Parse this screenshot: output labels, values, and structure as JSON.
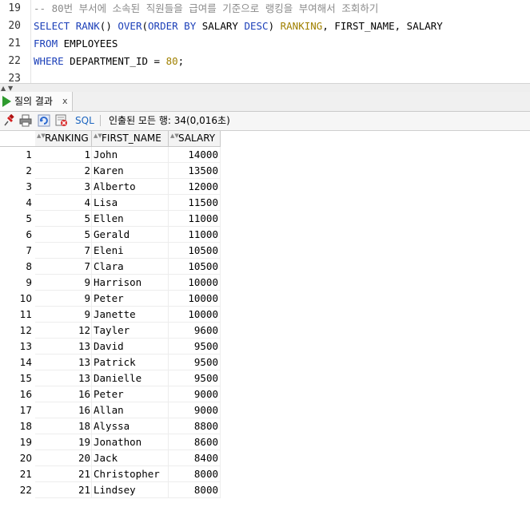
{
  "editor": {
    "lines": [
      {
        "num": "19",
        "comment": "-- 80번 부서에 소속된 직원들을 급여를 기준으로 랭킹을 부여해서 조회하기"
      },
      {
        "num": "20",
        "tokens": [
          "SELECT",
          " ",
          "RANK",
          "() ",
          "OVER",
          "(",
          "ORDER BY",
          " SALARY ",
          "DESC",
          ") ",
          "RANKING",
          ", FIRST_NAME, SALARY"
        ]
      },
      {
        "num": "21",
        "tokens": [
          "FROM",
          " EMPLOYEES"
        ]
      },
      {
        "num": "22",
        "tokens": [
          "WHERE",
          " DEPARTMENT_ID = ",
          "80",
          ";"
        ]
      },
      {
        "num": "23"
      }
    ]
  },
  "splitter": {
    "up_arrow": "▲",
    "down_arrow": "▼"
  },
  "results_tab": {
    "label": "질의 결과",
    "close": "x"
  },
  "toolbar": {
    "icons": [
      "pin-icon",
      "print-icon",
      "refresh-icon",
      "clear-icon"
    ],
    "sql_label": "SQL",
    "status": "인출된 모든 행: 34(0,016초)"
  },
  "grid": {
    "columns": [
      "RANKING",
      "FIRST_NAME",
      "SALARY"
    ],
    "sort_glyph": "▲▼",
    "rows": [
      {
        "n": "1",
        "ranking": "1",
        "first_name": "John",
        "salary": "14000"
      },
      {
        "n": "2",
        "ranking": "2",
        "first_name": "Karen",
        "salary": "13500"
      },
      {
        "n": "3",
        "ranking": "3",
        "first_name": "Alberto",
        "salary": "12000"
      },
      {
        "n": "4",
        "ranking": "4",
        "first_name": "Lisa",
        "salary": "11500"
      },
      {
        "n": "5",
        "ranking": "5",
        "first_name": "Ellen",
        "salary": "11000"
      },
      {
        "n": "6",
        "ranking": "5",
        "first_name": "Gerald",
        "salary": "11000"
      },
      {
        "n": "7",
        "ranking": "7",
        "first_name": "Eleni",
        "salary": "10500"
      },
      {
        "n": "8",
        "ranking": "7",
        "first_name": "Clara",
        "salary": "10500"
      },
      {
        "n": "9",
        "ranking": "9",
        "first_name": "Harrison",
        "salary": "10000"
      },
      {
        "n": "10",
        "ranking": "9",
        "first_name": "Peter",
        "salary": "10000"
      },
      {
        "n": "11",
        "ranking": "9",
        "first_name": "Janette",
        "salary": "10000"
      },
      {
        "n": "12",
        "ranking": "12",
        "first_name": "Tayler",
        "salary": "9600"
      },
      {
        "n": "13",
        "ranking": "13",
        "first_name": "David",
        "salary": "9500"
      },
      {
        "n": "14",
        "ranking": "13",
        "first_name": "Patrick",
        "salary": "9500"
      },
      {
        "n": "15",
        "ranking": "13",
        "first_name": "Danielle",
        "salary": "9500"
      },
      {
        "n": "16",
        "ranking": "16",
        "first_name": "Peter",
        "salary": "9000"
      },
      {
        "n": "17",
        "ranking": "16",
        "first_name": "Allan",
        "salary": "9000"
      },
      {
        "n": "18",
        "ranking": "18",
        "first_name": "Alyssa",
        "salary": "8800"
      },
      {
        "n": "19",
        "ranking": "19",
        "first_name": "Jonathon",
        "salary": "8600"
      },
      {
        "n": "20",
        "ranking": "20",
        "first_name": "Jack",
        "salary": "8400"
      },
      {
        "n": "21",
        "ranking": "21",
        "first_name": "Christopher",
        "salary": "8000"
      },
      {
        "n": "22",
        "ranking": "21",
        "first_name": "Lindsey",
        "salary": "8000"
      }
    ]
  }
}
